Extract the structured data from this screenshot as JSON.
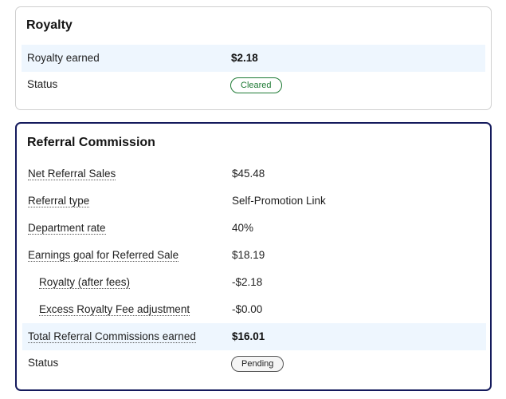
{
  "royalty": {
    "title": "Royalty",
    "rows": [
      {
        "label": "Royalty earned",
        "value": "$2.18"
      },
      {
        "label": "Status",
        "badge": "Cleared"
      }
    ]
  },
  "referral": {
    "title": "Referral Commission",
    "rows": [
      {
        "label": "Net Referral Sales",
        "value": "$45.48"
      },
      {
        "label": "Referral type",
        "value": "Self-Promotion Link"
      },
      {
        "label": "Department rate",
        "value": "40%"
      },
      {
        "label": "Earnings goal for Referred Sale",
        "value": "$18.19"
      },
      {
        "label": "Royalty (after fees)",
        "value": "-$2.18"
      },
      {
        "label": "Excess Royalty Fee adjustment",
        "value": "-$0.00"
      },
      {
        "label": "Total Referral Commissions earned",
        "value": "$16.01"
      },
      {
        "label": "Status",
        "badge": "Pending"
      }
    ]
  },
  "colors": {
    "referral_border": "#141a5c",
    "shaded_row": "#eef6fe",
    "cleared_badge": "#1e7a34",
    "pending_badge": "#555555"
  }
}
